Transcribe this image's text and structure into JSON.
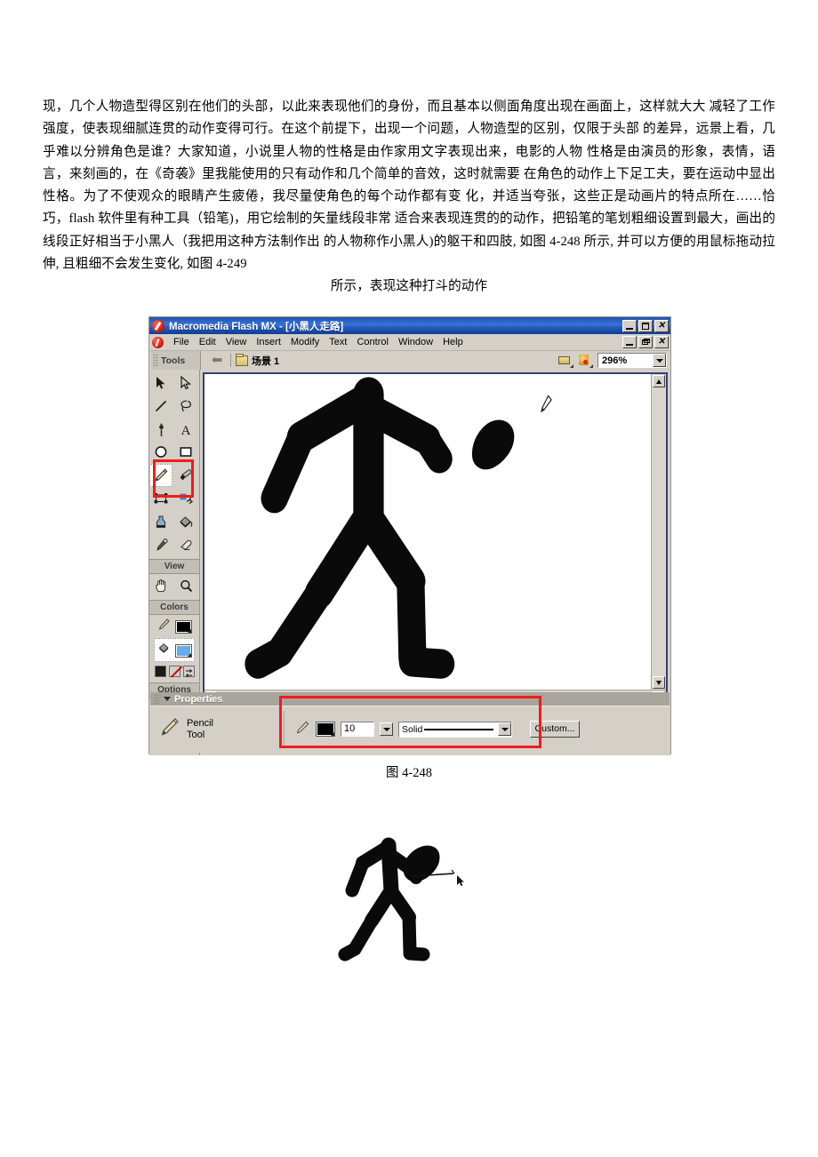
{
  "document": {
    "paragraph_lines": [
      "现，几个人物造型得区别在他们的头部，以此来表现他们的身份，而且基本以侧面角度出现在画面上，这样就大大",
      "减轻了工作强度，使表现细腻连贯的动作变得可行。在这个前提下，出现一个问题，人物造型的区别，仅限于头部",
      "的差异，远景上看，几乎难以分辨角色是谁？大家知道，小说里人物的性格是由作家用文字表现出来，电影的人物",
      "性格是由演员的形象，表情，语言，来刻画的，在《奇袭》里我能使用的只有动作和几个简单的音效，这时就需要",
      "在角色的动作上下足工夫，要在运动中显出性格。为了不使观众的眼睛产生疲倦，我尽量使角色的每个动作都有变",
      "化，并适当夸张，这些正是动画片的特点所在……恰巧，flash 软件里有种工具（铅笔)，用它绘制的矢量线段非常",
      "适合来表现连贯的的动作，把铅笔的笔划粗细设置到最大，画出的线段正好相当于小黑人（我把用这种方法制作出",
      "的人物称作小黑人)的躯干和四肢, 如图 4-248 所示, 并可以方便的用鼠标拖动拉伸, 且粗细不会发生变化, 如图 4-249"
    ],
    "paragraph_last_line": "所示，表现这种打斗的动作",
    "figure_caption_1": "图 4-248"
  },
  "flash_window": {
    "title": "Macromedia Flash MX - [小黑人走路]",
    "app_icon": "flash-logo-icon",
    "window_controls": {
      "minimize": "minimize-icon",
      "maximize": "maximize-icon",
      "close": "close-icon",
      "doc_minimize": "doc-minimize-icon",
      "doc_restore": "doc-restore-icon",
      "doc_close": "doc-close-icon"
    },
    "menu": [
      {
        "label": "File",
        "accel": "F"
      },
      {
        "label": "Edit",
        "accel": "E"
      },
      {
        "label": "View",
        "accel": "V"
      },
      {
        "label": "Insert",
        "accel": "I"
      },
      {
        "label": "Modify",
        "accel": "M"
      },
      {
        "label": "Text",
        "accel": "T"
      },
      {
        "label": "Control",
        "accel": "C"
      },
      {
        "label": "Window",
        "accel": "W"
      },
      {
        "label": "Help",
        "accel": "H"
      }
    ],
    "scene_bar": {
      "back_arrow": "back-arrow-icon",
      "scene_icon": "scene-icon",
      "scene_name": "场景 1",
      "edit_scene_icon": "edit-scene-icon",
      "edit_symbol_icon": "edit-symbol-icon",
      "zoom_value": "296%"
    },
    "tools_panel": {
      "caption": "Tools",
      "tools": [
        {
          "name": "arrow-tool",
          "selected": false
        },
        {
          "name": "subselection-tool",
          "selected": false
        },
        {
          "name": "line-tool",
          "selected": false
        },
        {
          "name": "lasso-tool",
          "selected": false
        },
        {
          "name": "pen-tool",
          "selected": false
        },
        {
          "name": "text-tool",
          "selected": false
        },
        {
          "name": "oval-tool",
          "selected": false
        },
        {
          "name": "rectangle-tool",
          "selected": false
        },
        {
          "name": "pencil-tool",
          "selected": true
        },
        {
          "name": "brush-tool",
          "selected": false
        },
        {
          "name": "free-transform-tool",
          "selected": false
        },
        {
          "name": "fill-transform-tool",
          "selected": false
        },
        {
          "name": "ink-bottle-tool",
          "selected": false
        },
        {
          "name": "paint-bucket-tool",
          "selected": false
        },
        {
          "name": "eyedropper-tool",
          "selected": false
        },
        {
          "name": "eraser-tool",
          "selected": false
        }
      ],
      "view_caption": "View",
      "view_tools": [
        {
          "name": "hand-tool"
        },
        {
          "name": "zoom-tool"
        }
      ],
      "colors_caption": "Colors",
      "colors": {
        "stroke_color": "#000000",
        "fill_color": "#69a9e8"
      },
      "options_caption": "Options",
      "options": [
        {
          "name": "pencil-mode-smooth-option"
        }
      ]
    },
    "stage": {
      "zoom": "296%",
      "drawing": "walking-stick-figure",
      "cursor": "pencil-cursor"
    },
    "properties_panel": {
      "title": "Properties",
      "tool_name_line1": "Pencil",
      "tool_name_line2": "Tool",
      "stroke_color": "#000000",
      "stroke_height": "10",
      "stroke_style": "Solid",
      "custom_button": "Custom..."
    },
    "annotations": {
      "accent_color": "#f21b1b",
      "boxes": [
        {
          "name": "pencil-tool-highlight-box"
        },
        {
          "name": "stroke-properties-highlight-box"
        }
      ]
    }
  },
  "figure2": {
    "name": "stick-figure-drag-illustration",
    "cursor": "arrow-cursor"
  }
}
